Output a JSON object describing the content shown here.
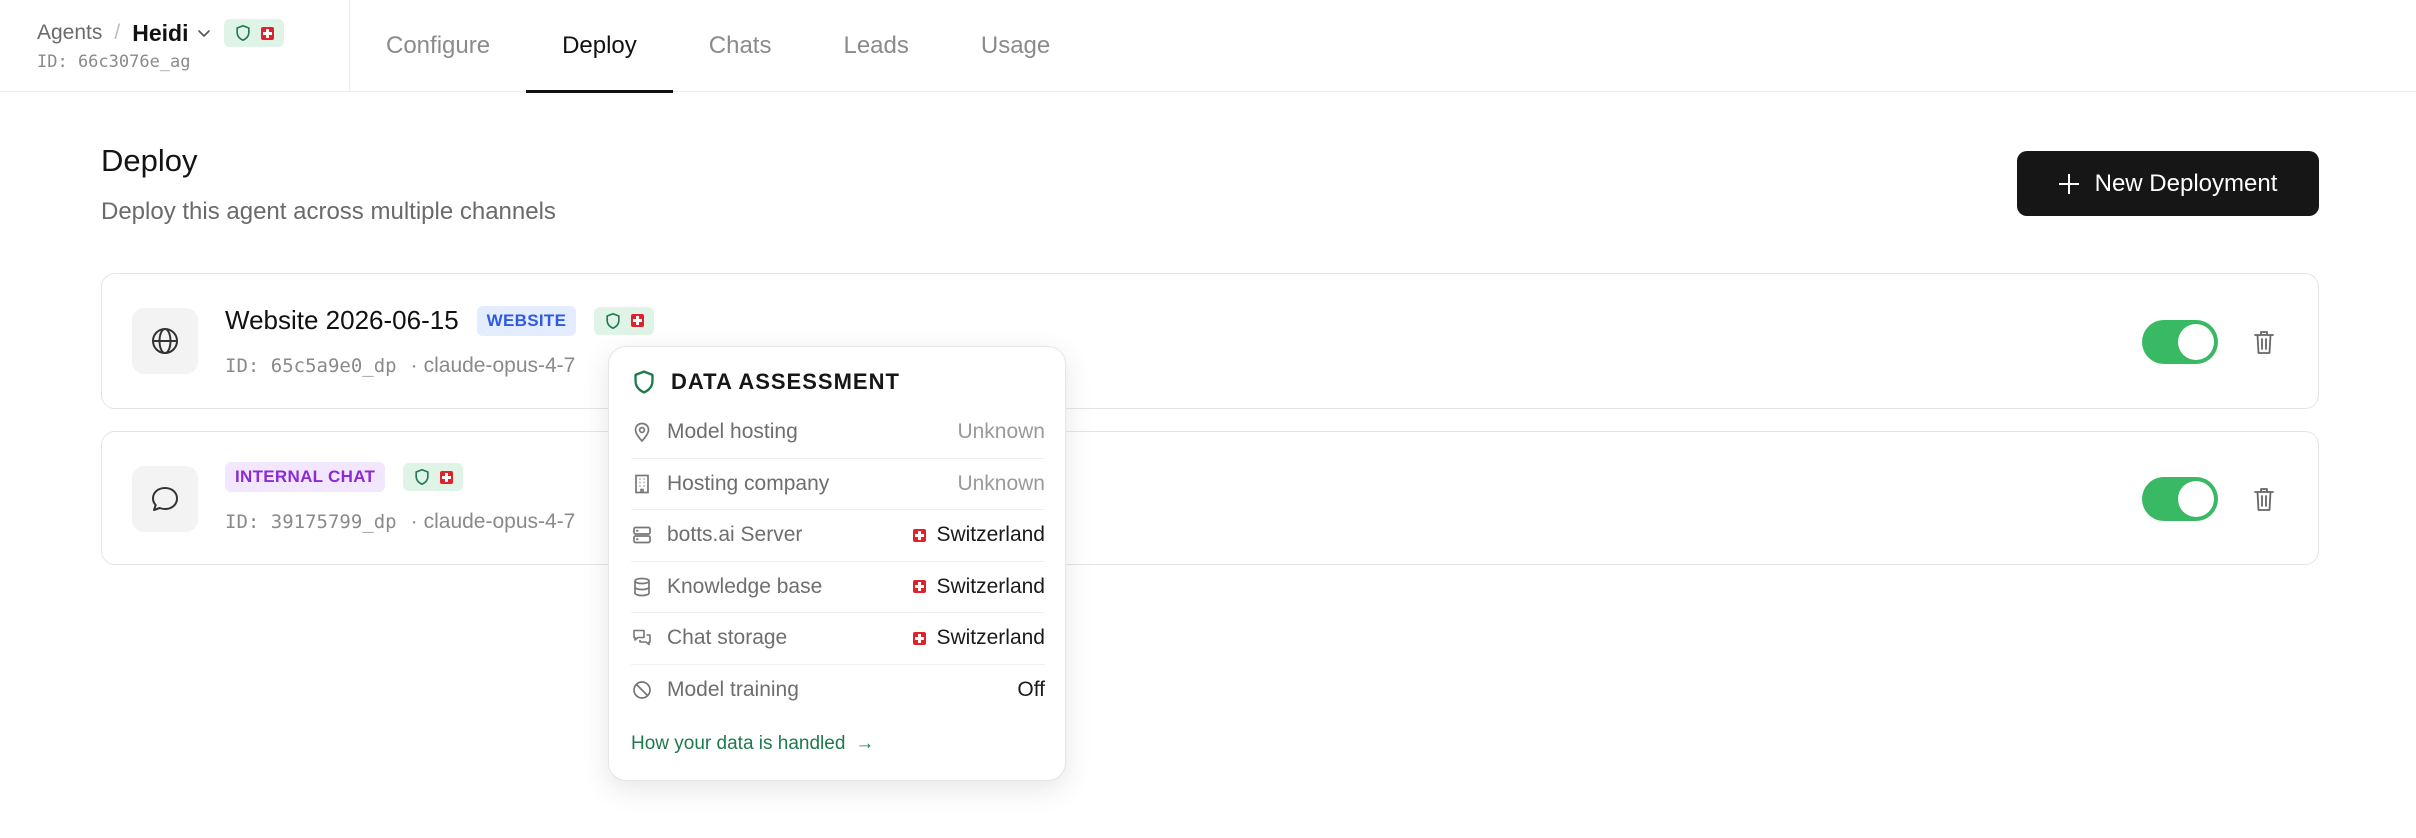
{
  "breadcrumb": {
    "root": "Agents",
    "separator": "/",
    "agent_name": "Heidi",
    "agent_id": "ID: 66c3076e_ag"
  },
  "tabs": [
    {
      "label": "Configure",
      "active": false
    },
    {
      "label": "Deploy",
      "active": true
    },
    {
      "label": "Chats",
      "active": false
    },
    {
      "label": "Leads",
      "active": false
    },
    {
      "label": "Usage",
      "active": false
    }
  ],
  "header": {
    "title": "Deploy",
    "subtitle": "Deploy this agent across multiple channels",
    "new_button_label": "New Deployment"
  },
  "deployments": [
    {
      "icon": "globe-icon",
      "title": "Website 2026-06-15",
      "tag": "WEBSITE",
      "id": "ID: 65c5a9e0_dp",
      "model": "claude-opus-4-7",
      "enabled": true
    },
    {
      "icon": "chat-bubble-icon",
      "title": "",
      "tag": "INTERNAL CHAT",
      "id": "ID: 39175799_dp",
      "model": "claude-opus-4-7",
      "enabled": true
    }
  ],
  "meta_separator": "·",
  "popover": {
    "title": "DATA ASSESSMENT",
    "rows": [
      {
        "icon": "map-pin-icon",
        "label": "Model hosting",
        "value": "Unknown",
        "flag": false
      },
      {
        "icon": "building-icon",
        "label": "Hosting company",
        "value": "Unknown",
        "flag": false
      },
      {
        "icon": "server-icon",
        "label": "botts.ai Server",
        "value": "Switzerland",
        "flag": true
      },
      {
        "icon": "database-icon",
        "label": "Knowledge base",
        "value": "Switzerland",
        "flag": true
      },
      {
        "icon": "chat-storage-icon",
        "label": "Chat storage",
        "value": "Switzerland",
        "flag": true
      },
      {
        "icon": "ban-icon",
        "label": "Model training",
        "value": "Off",
        "flag": false
      }
    ],
    "link_label": "How your data is handled",
    "link_arrow": "→"
  },
  "colors": {
    "accent_green": "#39b964",
    "link_green": "#1e7a4d",
    "badge_green_bg": "#dff3e6",
    "website_tag": "#2d5be3",
    "chat_tag": "#8a2bd6",
    "flag_red": "#e0222a"
  }
}
